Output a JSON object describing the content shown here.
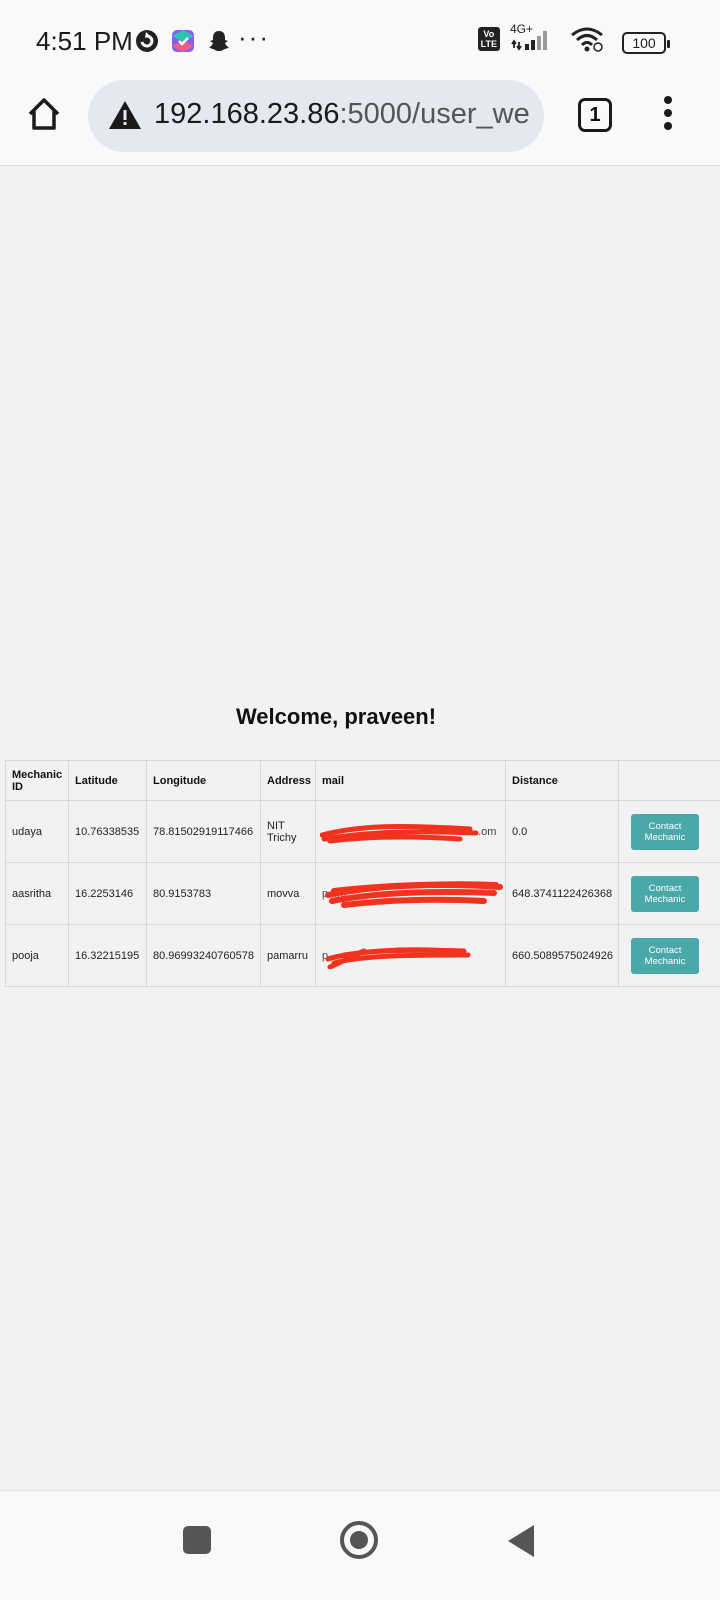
{
  "status_bar": {
    "time": "4:51 PM",
    "dots": "···",
    "volte": "Vo LTE",
    "network": "4G+",
    "battery": "100"
  },
  "browser": {
    "url_host": "192.168.23.86",
    "url_rest": ":5000/user_we",
    "tab_count": "1"
  },
  "page": {
    "welcome": "Welcome, praveen!",
    "table": {
      "headers": [
        "Mechanic ID",
        "Latitude",
        "Longitude",
        "Address",
        "mail",
        "Distance",
        ""
      ],
      "rows": [
        {
          "id": "udaya",
          "lat": "10.76338535",
          "lon": "78.81502919117466",
          "address": "NIT Trichy",
          "mail": "...om",
          "distance": "0.0",
          "action": "Contact Mechanic"
        },
        {
          "id": "aasritha",
          "lat": "16.2253146",
          "lon": "80.9153783",
          "address": "movva",
          "mail": "p...m",
          "distance": "648.3741122426368",
          "action": "Contact Mechanic"
        },
        {
          "id": "pooja",
          "lat": "16.32215195",
          "lon": "80.96993240760578",
          "address": "pamarru",
          "mail": "p...",
          "distance": "660.5089575024926",
          "action": "Contact Mechanic"
        }
      ]
    }
  },
  "colors": {
    "button": "#4aa8a8",
    "redaction": "#f0321e",
    "page_bg": "#f2f2f2"
  }
}
